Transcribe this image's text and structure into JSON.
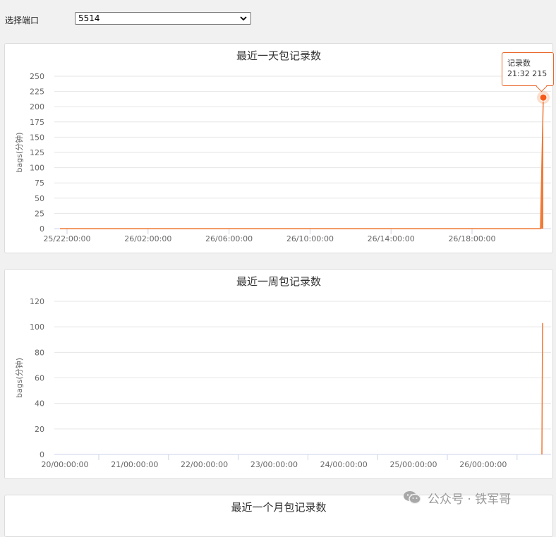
{
  "port_selector": {
    "label": "选择端口",
    "selected": "5514"
  },
  "charts": {
    "day": {
      "title": "最近一天包记录数",
      "ylabel": "bags(分钟)",
      "series_color": "#f07a36",
      "tooltip": {
        "series": "记录数",
        "value": "21:32 215"
      }
    },
    "week": {
      "title": "最近一周包记录数",
      "ylabel": "bags(分钟)",
      "series_color": "#f07a36"
    },
    "month": {
      "title": "最近一个月包记录数"
    }
  },
  "chart_data": [
    {
      "type": "area",
      "title": "最近一天包记录数",
      "ylabel": "bags(分钟)",
      "xlabel": "",
      "ylim": [
        0,
        250
      ],
      "yticks": [
        0,
        25,
        50,
        75,
        100,
        125,
        150,
        175,
        200,
        225,
        250
      ],
      "x_tick_labels": [
        "25/22:00:00",
        "26/02:00:00",
        "26/06:00:00",
        "26/10:00:00",
        "26/14:00:00",
        "26/18:00:00"
      ],
      "x": [
        "25/21:40",
        "26/21:28",
        "26/21:30",
        "26/21:32"
      ],
      "values": [
        0,
        0,
        0,
        215
      ],
      "grid": true,
      "highlight": {
        "x": "21:32",
        "value": 215
      }
    },
    {
      "type": "area",
      "title": "最近一周包记录数",
      "ylabel": "bags(分钟)",
      "xlabel": "",
      "ylim": [
        0,
        120
      ],
      "yticks": [
        0,
        20,
        40,
        60,
        80,
        100,
        120
      ],
      "x_tick_labels": [
        "20/00:00:00",
        "21/00:00:00",
        "22/00:00:00",
        "23/00:00:00",
        "24/00:00:00",
        "25/00:00:00",
        "26/00:00:00"
      ],
      "x": [
        "26/21:30",
        "26/21:32"
      ],
      "values": [
        0,
        103
      ],
      "grid": true
    }
  ],
  "watermark": {
    "text": "公众号 · 铁军哥",
    "icon": "wechat-icon"
  }
}
